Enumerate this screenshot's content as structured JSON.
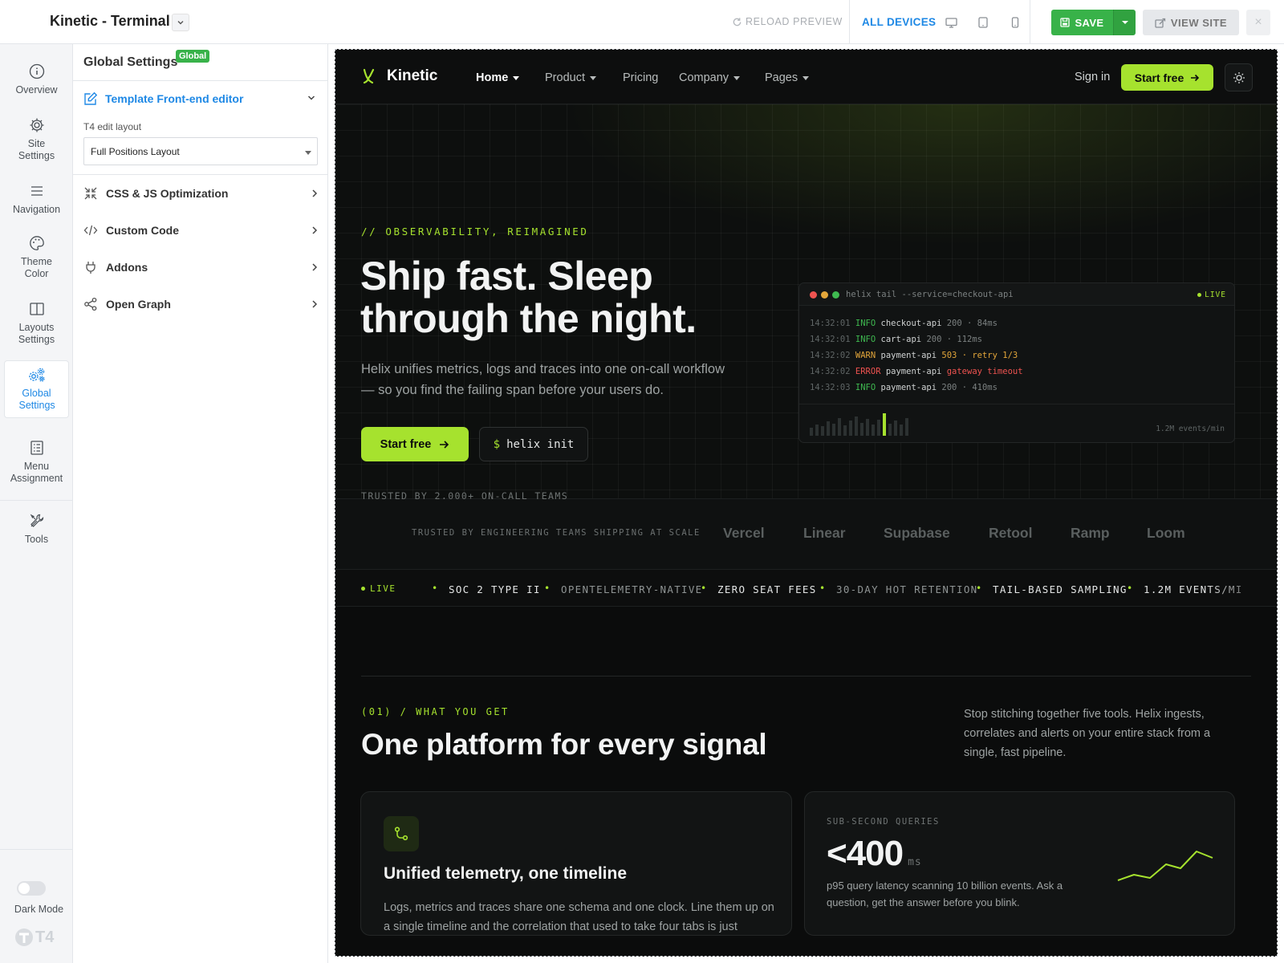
{
  "app": {
    "title": "Kinetic - Terminal"
  },
  "topbar": {
    "reload_label": "RELOAD PREVIEW",
    "all_devices_label": "ALL DEVICES",
    "devices": [
      "desktop-icon",
      "tablet-icon",
      "mobile-icon"
    ],
    "save_label": "SAVE",
    "view_site_label": "VIEW SITE",
    "close_label": "×"
  },
  "rail": {
    "items": [
      {
        "label": "Overview",
        "icon": "info-icon"
      },
      {
        "label": "Site Settings",
        "icon": "gear-icon"
      },
      {
        "label": "Navigation",
        "icon": "menu-icon"
      },
      {
        "label": "Theme Color",
        "icon": "palette-icon"
      },
      {
        "label": "Layouts Settings",
        "icon": "layout-icon"
      },
      {
        "label": "Global Settings",
        "icon": "gears-icon",
        "active": true
      },
      {
        "label": "Menu Assignment",
        "icon": "list-icon"
      },
      {
        "label": "Tools",
        "icon": "tools-icon"
      }
    ],
    "dark_mode_label": "Dark Mode",
    "dark_mode_on": false,
    "logo_text": "T4"
  },
  "panel": {
    "title": "Global Settings",
    "badge": "Global",
    "open_section": {
      "label": "Template Front-end editor",
      "field_label": "T4 edit layout",
      "field_value": "Full Positions Layout"
    },
    "sections": [
      {
        "label": "CSS & JS Optimization",
        "icon": "compress-icon"
      },
      {
        "label": "Custom Code",
        "icon": "code-icon"
      },
      {
        "label": "Addons",
        "icon": "plug-icon"
      },
      {
        "label": "Open Graph",
        "icon": "share-icon"
      }
    ]
  },
  "site": {
    "brand": "Kinetic",
    "nav": [
      "Home",
      "Product",
      "Pricing",
      "Company",
      "Pages"
    ],
    "signin": "Sign in",
    "nav_cta": "Start free",
    "hero": {
      "eyebrow": "// OBSERVABILITY, REIMAGINED",
      "title": "Ship fast. Sleep through the night.",
      "subtitle": "Helix unifies metrics, logs and traces into one on-call workflow — so you find the failing span before your users do.",
      "cta": "Start free",
      "cmd_prefix": "$",
      "cmd": "helix init",
      "trusted": "TRUSTED BY 2,000+ ON-CALL TEAMS"
    },
    "terminal": {
      "command": "helix tail --service=checkout-api",
      "live": "LIVE",
      "lines": [
        {
          "time": "14:32:01",
          "level": "INFO",
          "service": "checkout-api",
          "detail": "200 · 84ms"
        },
        {
          "time": "14:32:01",
          "level": "INFO",
          "service": "cart-api",
          "detail": "200 · 112ms"
        },
        {
          "time": "14:32:02",
          "level": "WARN",
          "service": "payment-api",
          "detail": "503 · retry 1/3"
        },
        {
          "time": "14:32:02",
          "level": "ERROR",
          "service": "payment-api",
          "detail": "gateway timeout"
        },
        {
          "time": "14:32:03",
          "level": "INFO",
          "service": "payment-api",
          "detail": "200 · 410ms"
        }
      ],
      "rate": "1.2M events/min"
    },
    "logos_label": "TRUSTED BY ENGINEERING TEAMS SHIPPING AT SCALE",
    "logos": [
      "Vercel",
      "Linear",
      "Supabase",
      "Retool",
      "Ramp",
      "Loom"
    ],
    "ticker": {
      "live": "LIVE",
      "items": [
        "SOC 2 TYPE II",
        "OPENTELEMETRY-NATIVE",
        "ZERO SEAT FEES",
        "30-DAY HOT RETENTION",
        "TAIL-BASED SAMPLING",
        "1.2M EVENTS/MI"
      ]
    },
    "section": {
      "eyebrow": "(01) / WHAT YOU GET",
      "title": "One platform for every signal",
      "description": "Stop stitching together five tools. Helix ingests, correlates and alerts on your entire stack from a single, fast pipeline."
    },
    "card1": {
      "icon": "branch-icon",
      "title": "Unified telemetry, one timeline",
      "body": "Logs, metrics and traces share one schema and one clock. Line them up on a single timeline and the correlation that used to take four tabs is just"
    },
    "card2": {
      "label": "SUB-SECOND QUERIES",
      "value": "<400",
      "unit": "ms",
      "body": "p95 query latency scanning 10 billion events. Ask a question, get the answer before you blink."
    }
  },
  "colors": {
    "accent_green": "#a6e22e",
    "save_green": "#38b249",
    "editor_blue": "#1e88e5",
    "site_bg": "#0b0c0c"
  }
}
